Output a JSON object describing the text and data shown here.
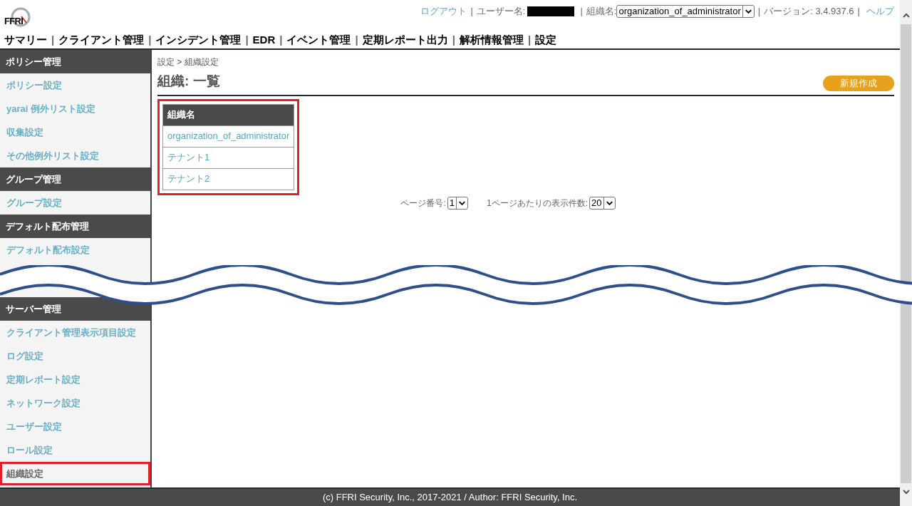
{
  "header": {
    "logo": "FFRI",
    "separator": "|",
    "logout": "ログアウト",
    "user_label": "ユーザー名:",
    "org_label": "組織名:",
    "org_value": "organization_of_administrator",
    "version": "バージョン: 3.4.937.6",
    "help": "ヘルプ"
  },
  "nav": [
    {
      "label": "サマリー"
    },
    {
      "label": "クライアント管理"
    },
    {
      "label": "インシデント管理"
    },
    {
      "label": "EDR"
    },
    {
      "label": "イベント管理"
    },
    {
      "label": "定期レポート出力"
    },
    {
      "label": "解析情報管理"
    },
    {
      "label": "設定"
    }
  ],
  "sidebar": [
    {
      "kind": "header",
      "label": "ポリシー管理"
    },
    {
      "kind": "item",
      "label": "ポリシー設定",
      "selected": false,
      "highlighted": false
    },
    {
      "kind": "item",
      "label": "yarai 例外リスト設定",
      "selected": false,
      "highlighted": false
    },
    {
      "kind": "item",
      "label": "収集設定",
      "selected": false,
      "highlighted": false
    },
    {
      "kind": "item",
      "label": "その他例外リスト設定",
      "selected": false,
      "highlighted": false
    },
    {
      "kind": "header",
      "label": "グループ管理"
    },
    {
      "kind": "item",
      "label": "グループ設定",
      "selected": false,
      "highlighted": false
    },
    {
      "kind": "header",
      "label": "デフォルト配布管理"
    },
    {
      "kind": "item",
      "label": "デフォルト配布設定",
      "selected": false,
      "highlighted": false
    },
    {
      "kind": "gap"
    },
    {
      "kind": "header",
      "label": "サーバー管理"
    },
    {
      "kind": "item",
      "label": "クライアント管理表示項目設定",
      "selected": false,
      "highlighted": false
    },
    {
      "kind": "item",
      "label": "ログ設定",
      "selected": false,
      "highlighted": false
    },
    {
      "kind": "item",
      "label": "定期レポート設定",
      "selected": false,
      "highlighted": false
    },
    {
      "kind": "item",
      "label": "ネットワーク設定",
      "selected": false,
      "highlighted": false
    },
    {
      "kind": "item",
      "label": "ユーザー設定",
      "selected": false,
      "highlighted": false
    },
    {
      "kind": "item",
      "label": "ロール設定",
      "selected": false,
      "highlighted": false
    },
    {
      "kind": "item",
      "label": "組織設定",
      "selected": true,
      "highlighted": true
    }
  ],
  "main": {
    "breadcrumb": "設定 > 組織設定",
    "title": "組織: 一覧",
    "new_button": "新規作成",
    "table": {
      "highlighted": true,
      "columns": [
        "組織名"
      ],
      "rows": [
        [
          "organization_of_administrator"
        ],
        [
          "テナント1"
        ],
        [
          "テナント2"
        ]
      ]
    },
    "pagination": {
      "page_label": "ページ番号:",
      "page_value": "1",
      "per_page_label": "1ページあたりの表示件数:",
      "per_page_value": "20"
    }
  },
  "footer": "(c) FFRI Security, Inc., 2017-2021 / Author: FFRI Security, Inc."
}
